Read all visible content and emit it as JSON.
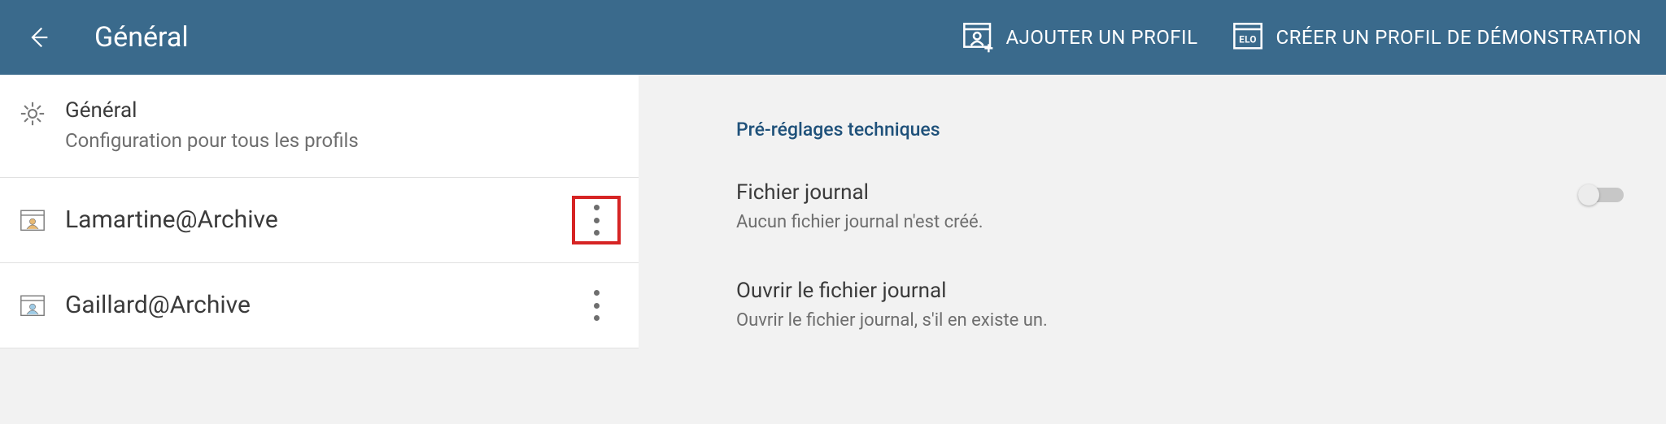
{
  "appbar": {
    "title": "Général",
    "actions": {
      "add_profile": "AJOUTER UN PROFIL",
      "create_demo_profile": "CRÉER UN PROFIL DE DÉMONSTRATION"
    }
  },
  "left": {
    "general": {
      "title": "Général",
      "subtitle": "Configuration pour tous les profils"
    },
    "profiles": [
      {
        "name": "Lamartine@Archive",
        "menu_highlighted": true
      },
      {
        "name": "Gaillard@Archive",
        "menu_highlighted": false
      }
    ]
  },
  "right": {
    "section_header": "Pré-réglages techniques",
    "log_file": {
      "title": "Fichier journal",
      "subtitle": "Aucun fichier journal n'est créé.",
      "enabled": false
    },
    "open_log_file": {
      "title": "Ouvrir le fichier journal",
      "subtitle": "Ouvrir le fichier journal, s'il en existe un."
    }
  },
  "colors": {
    "appbar_bg": "#3a6a8c",
    "accent": "#1f517a",
    "highlight_border": "#d62424"
  }
}
